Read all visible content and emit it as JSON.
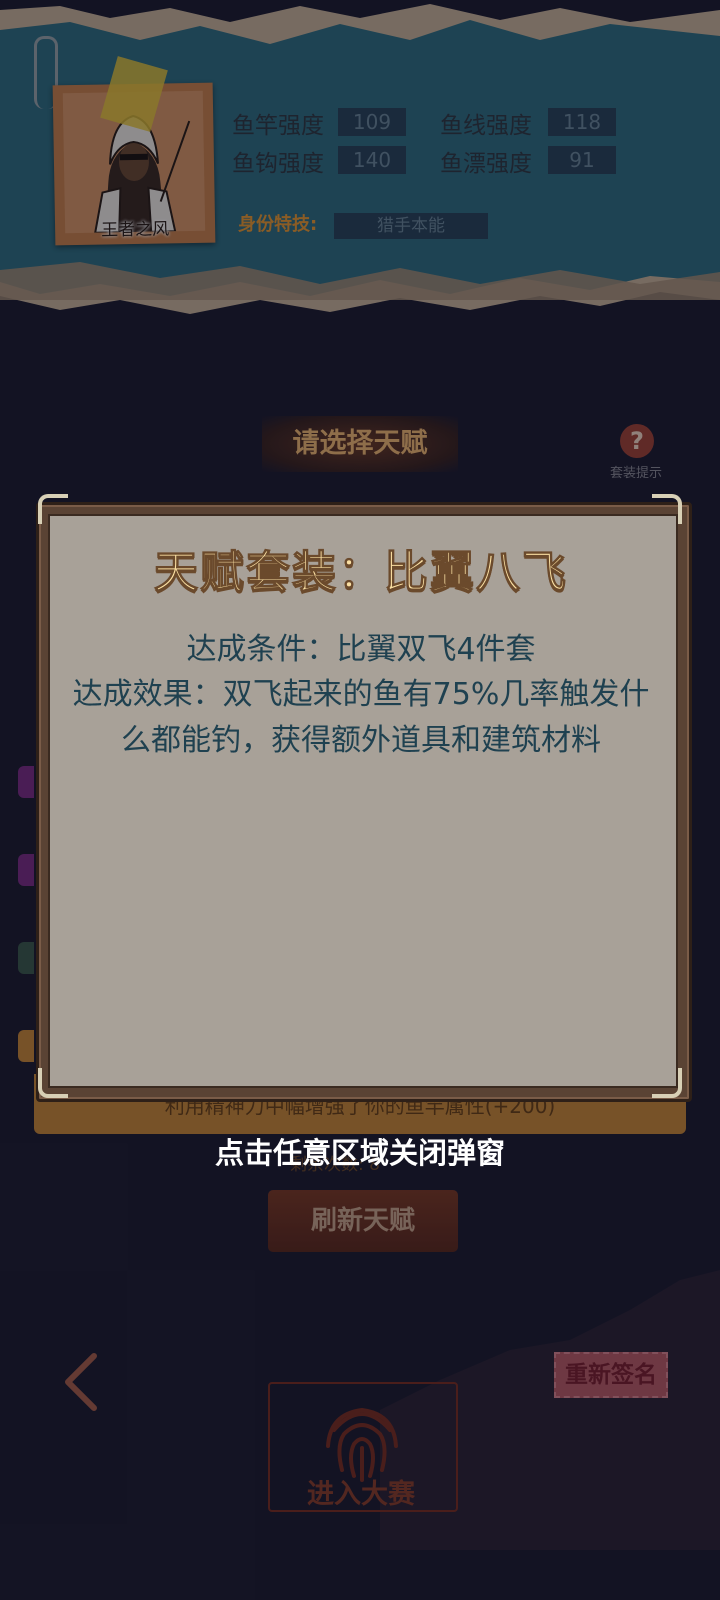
{
  "header": {
    "hero_name": "王者之风",
    "stats": [
      {
        "label": "鱼竿强度",
        "value": "109"
      },
      {
        "label": "鱼线强度",
        "value": "118"
      },
      {
        "label": "鱼钩强度",
        "value": "140"
      },
      {
        "label": "鱼漂强度",
        "value": "91"
      }
    ],
    "skill_label": "身份特技:",
    "skill_value": "猎手本能"
  },
  "talent": {
    "title": "请选择天赋",
    "hint_icon": "?",
    "hint_label": "套装提示",
    "description": "利用精神力中幅增强了你的鱼竿属性(+200)",
    "remaining": "剩余次数: 8",
    "refresh_label": "刷新天赋"
  },
  "bottom": {
    "resign_label": "重新签名",
    "enter_label": "进入大赛"
  },
  "modal": {
    "title": "天赋套装：比翼八飞",
    "condition": "达成条件：比翼双飞4件套",
    "effect": "达成效果：双飞起来的鱼有75%几率触发什么都能钓，获得额外道具和建筑材料",
    "close_tip": "点击任意区域关闭弹窗"
  },
  "colors": {
    "teal_paper": "#2f6f82",
    "modal_panel": "#a8a198",
    "modal_text": "#1f4150",
    "accent_orange": "#e99a33"
  }
}
